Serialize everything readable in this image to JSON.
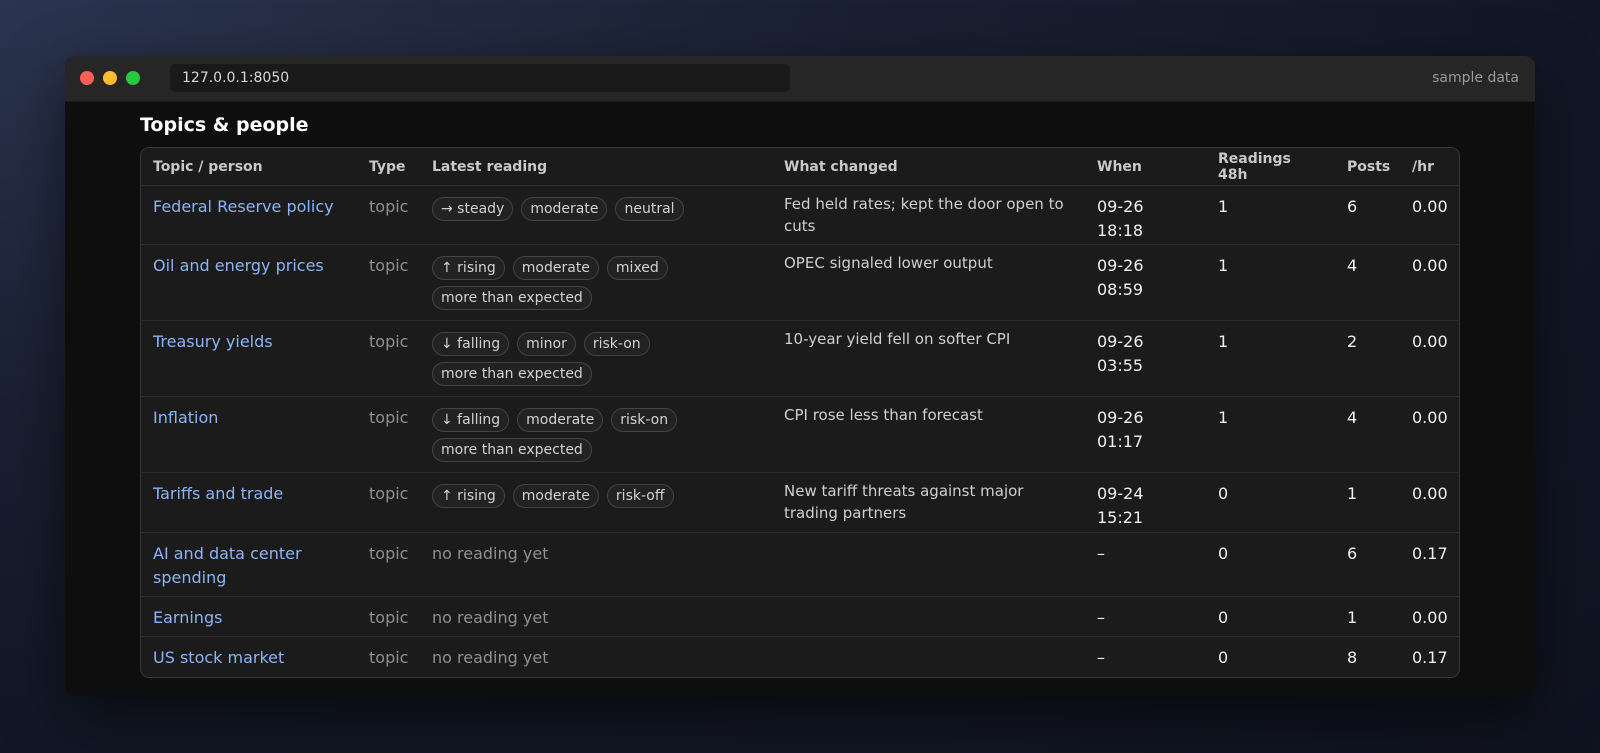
{
  "window": {
    "url": "127.0.0.1:8050",
    "note": "sample data"
  },
  "section": {
    "title": "Topics & people"
  },
  "table": {
    "headers": [
      "Topic / person",
      "Type",
      "Latest reading",
      "What changed",
      "When",
      "Readings 48h",
      "Posts",
      "/hr"
    ],
    "rows": [
      {
        "name": "Federal Reserve policy",
        "type": "topic",
        "tags": [
          "→ steady",
          "moderate",
          "neutral"
        ],
        "changed": "Fed held rates; kept the door open to cuts",
        "when": "09-26 18:18",
        "readings": "1",
        "posts": "6",
        "rate": "0.00"
      },
      {
        "name": "Oil and energy prices",
        "type": "topic",
        "tags": [
          "↑ rising",
          "moderate",
          "mixed",
          "more than expected"
        ],
        "changed": "OPEC signaled lower output",
        "when": "09-26 08:59",
        "readings": "1",
        "posts": "4",
        "rate": "0.00"
      },
      {
        "name": "Treasury yields",
        "type": "topic",
        "tags": [
          "↓ falling",
          "minor",
          "risk-on",
          "more than expected"
        ],
        "changed": "10-year yield fell on softer CPI",
        "when": "09-26 03:55",
        "readings": "1",
        "posts": "2",
        "rate": "0.00"
      },
      {
        "name": "Inflation",
        "type": "topic",
        "tags": [
          "↓ falling",
          "moderate",
          "risk-on",
          "more than expected"
        ],
        "changed": "CPI rose less than forecast",
        "when": "09-26 01:17",
        "readings": "1",
        "posts": "4",
        "rate": "0.00"
      },
      {
        "name": "Tariffs and trade",
        "type": "topic",
        "tags": [
          "↑ rising",
          "moderate",
          "risk-off"
        ],
        "changed": "New tariff threats against major trading partners",
        "when": "09-24 15:21",
        "readings": "0",
        "posts": "1",
        "rate": "0.00"
      },
      {
        "name": "AI and data center spending",
        "type": "topic",
        "reading_text": "no reading yet",
        "changed": "",
        "when": "–",
        "readings": "0",
        "posts": "6",
        "rate": "0.17"
      },
      {
        "name": "Earnings",
        "type": "topic",
        "reading_text": "no reading yet",
        "changed": "",
        "when": "–",
        "readings": "0",
        "posts": "1",
        "rate": "0.00"
      },
      {
        "name": "US stock market",
        "type": "topic",
        "reading_text": "no reading yet",
        "changed": "",
        "when": "–",
        "readings": "0",
        "posts": "8",
        "rate": "0.17"
      }
    ]
  },
  "colors": {
    "link": "#8ab4f8",
    "window_bg": "#0e0e0e",
    "table_bg": "#1b1b1b",
    "traffic_red": "#ff5f57",
    "traffic_yellow": "#febc2e",
    "traffic_green": "#28c840"
  }
}
